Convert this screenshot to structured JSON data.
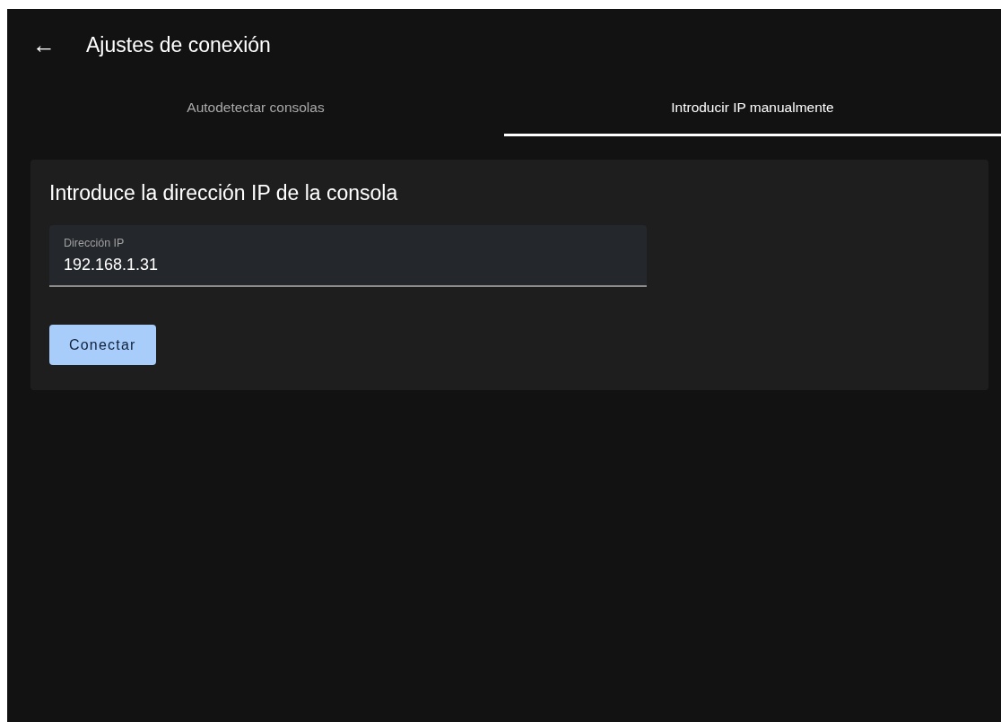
{
  "app_bar": {
    "back_icon": "←",
    "title": "Ajustes de conexión"
  },
  "tabs": [
    {
      "label": "Autodetectar consolas",
      "selected": false
    },
    {
      "label": "Introducir IP manualmente",
      "selected": true
    }
  ],
  "card": {
    "heading": "Introduce la dirección IP de la consola",
    "field": {
      "label": "Dirección IP",
      "value": "192.168.1.31"
    },
    "button": "Conectar"
  }
}
